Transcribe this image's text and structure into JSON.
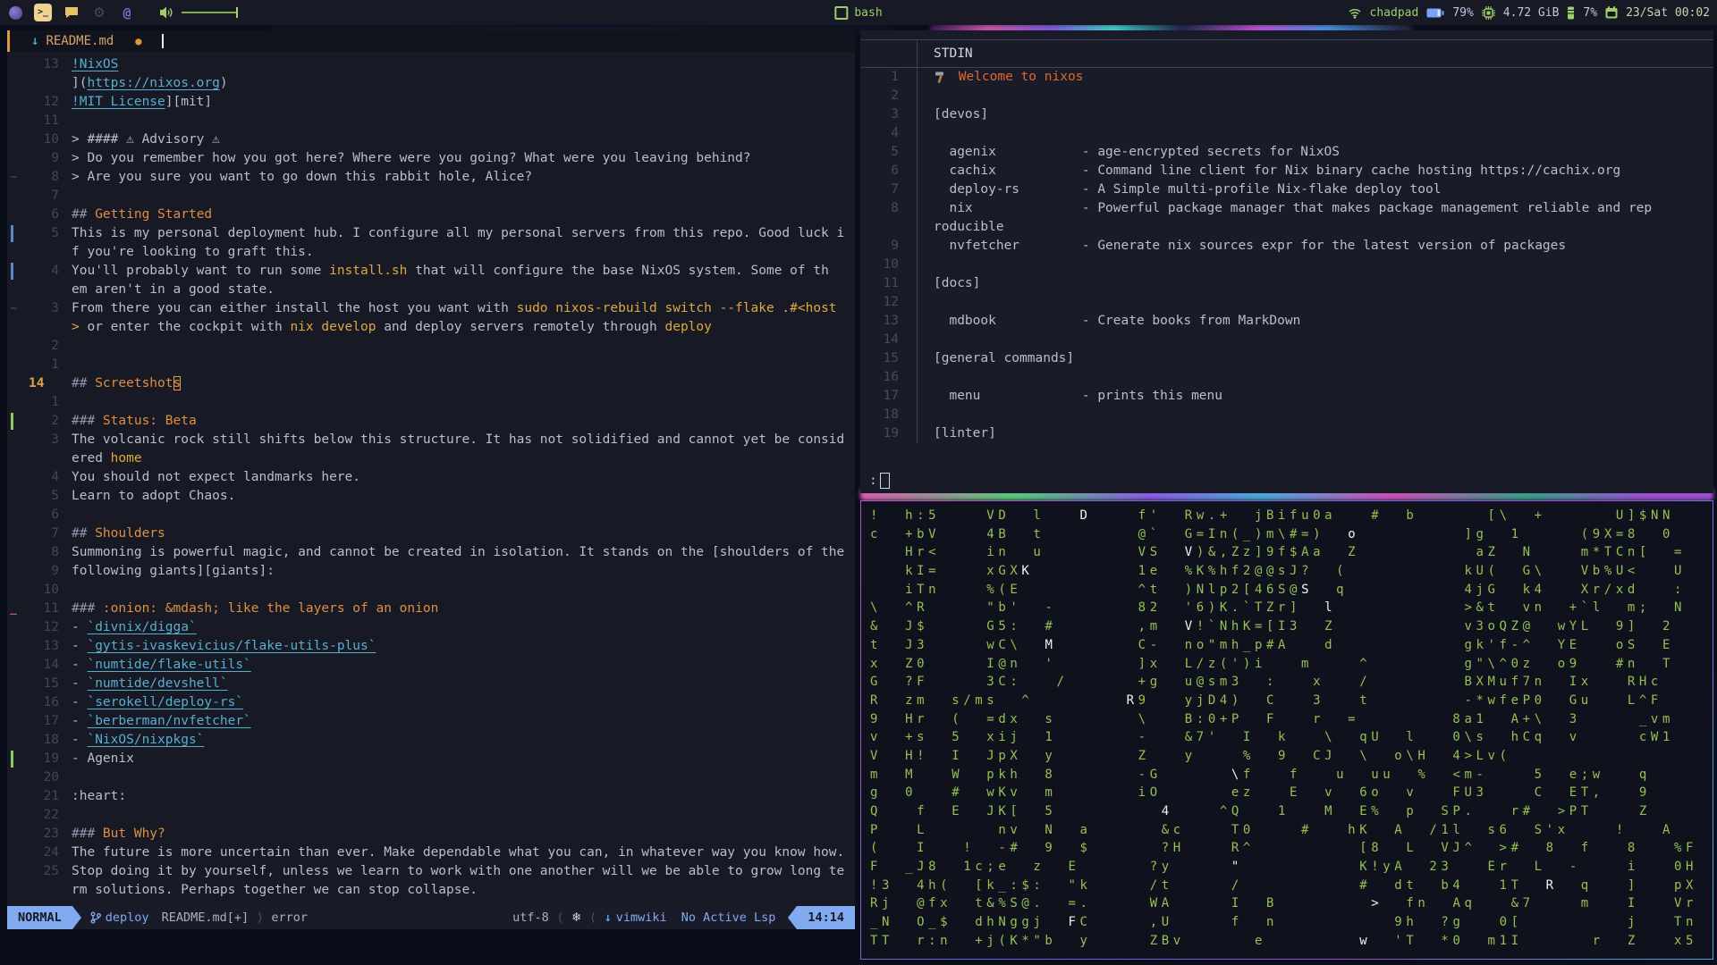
{
  "topbar": {
    "center_label": "bash",
    "host": "chadpad",
    "battery": "79%",
    "memory": "4.72 GiB",
    "cpu": "7%",
    "clock": "23/Sat 00:02",
    "accent_green": "#9ece6a",
    "accent_blue": "#7aa2f7"
  },
  "editor": {
    "winbar": {
      "icon": "↓",
      "file": "README.md",
      "modified_dot": "●"
    },
    "lines": [
      {
        "n": "13",
        "s": "",
        "g": [
          [
            "link",
            "!NixOS"
          ]
        ]
      },
      {
        "n": "",
        "s": "",
        "g": [
          [
            "plain",
            "]("
          ],
          [
            "link",
            "https://nixos.org"
          ],
          [
            "plain",
            ")"
          ]
        ]
      },
      {
        "n": "12",
        "s": "",
        "g": [
          [
            "link",
            "!MIT License"
          ],
          [
            "plain",
            "][mit]"
          ]
        ]
      },
      {
        "n": "11",
        "s": "",
        "g": []
      },
      {
        "n": "10",
        "s": "",
        "g": [
          [
            "plain",
            "> #### ⚠ Advisory ⚠"
          ]
        ]
      },
      {
        "n": "9",
        "s": "",
        "g": [
          [
            "plain",
            "> Do you remember how you got here? Where were you going? What were you leaving behind?"
          ]
        ]
      },
      {
        "n": "8",
        "s": "~",
        "g": [
          [
            "plain",
            "> Are you sure you want to go down this rabbit hole, Alice?"
          ]
        ]
      },
      {
        "n": "7",
        "s": "",
        "g": []
      },
      {
        "n": "6",
        "s": "",
        "g": [
          [
            "hash",
            "## "
          ],
          [
            "header",
            "Getting Started"
          ]
        ]
      },
      {
        "n": "5",
        "s": "ch",
        "g": [
          [
            "plain",
            "This is my personal deployment hub. I configure all my personal servers from this repo. Good luck i"
          ]
        ]
      },
      {
        "n": "",
        "s": "",
        "g": [
          [
            "plain",
            "f you're looking to graft this."
          ]
        ]
      },
      {
        "n": "4",
        "s": "ch",
        "g": [
          [
            "plain",
            "You'll probably want to run some "
          ],
          [
            "code",
            "install.sh"
          ],
          [
            "plain",
            " that will configure the base NixOS system. Some of th"
          ]
        ]
      },
      {
        "n": "",
        "s": "",
        "g": [
          [
            "plain",
            "em aren't in a good state."
          ]
        ]
      },
      {
        "n": "3",
        "s": "~",
        "g": [
          [
            "plain",
            "From there you can either install the host you want with "
          ],
          [
            "code",
            "sudo nixos-rebuild switch --flake .#<host"
          ]
        ]
      },
      {
        "n": "",
        "s": "",
        "g": [
          [
            "code",
            ">"
          ],
          [
            "plain",
            " or enter the cockpit with "
          ],
          [
            "code",
            "nix develop"
          ],
          [
            "plain",
            " and deploy servers remotely through "
          ],
          [
            "code",
            "deploy"
          ]
        ]
      },
      {
        "n": "2",
        "s": "",
        "g": []
      },
      {
        "n": "1",
        "s": "",
        "g": []
      },
      {
        "n": "14",
        "s": "",
        "c": true,
        "g": [
          [
            "hash",
            "## "
          ],
          [
            "header",
            "Screetshot"
          ],
          [
            "cursor",
            "s"
          ]
        ]
      },
      {
        "n": "1",
        "s": "",
        "g": []
      },
      {
        "n": "2",
        "s": "ad",
        "g": [
          [
            "hash",
            "### "
          ],
          [
            "header",
            "Status: Beta"
          ]
        ]
      },
      {
        "n": "3",
        "s": "",
        "g": [
          [
            "plain",
            "The volcanic rock still shifts below this structure. It has not solidified and cannot yet be consid"
          ]
        ]
      },
      {
        "n": "",
        "s": "",
        "g": [
          [
            "plain",
            "ered "
          ],
          [
            "code",
            "home"
          ]
        ]
      },
      {
        "n": "4",
        "s": "",
        "g": [
          [
            "plain",
            "You should not expect landmarks here."
          ]
        ]
      },
      {
        "n": "5",
        "s": "",
        "g": [
          [
            "plain",
            "Learn to adopt Chaos."
          ]
        ]
      },
      {
        "n": "6",
        "s": "",
        "g": []
      },
      {
        "n": "7",
        "s": "",
        "g": [
          [
            "hash",
            "## "
          ],
          [
            "header",
            "Shoulders"
          ]
        ]
      },
      {
        "n": "8",
        "s": "",
        "g": [
          [
            "plain",
            "Summoning is powerful magic, and cannot be created in isolation. It stands on the [shoulders of the"
          ]
        ]
      },
      {
        "n": "9",
        "s": "",
        "g": [
          [
            "plain",
            "following giants][giants]:"
          ]
        ]
      },
      {
        "n": "10",
        "s": "",
        "g": []
      },
      {
        "n": "11",
        "s": "de",
        "g": [
          [
            "hash",
            "### "
          ],
          [
            "header",
            ":onion: &mdash; like the layers of an onion"
          ]
        ]
      },
      {
        "n": "12",
        "s": "",
        "g": [
          [
            "plain",
            "- "
          ],
          [
            "link",
            "`divnix/digga`"
          ]
        ]
      },
      {
        "n": "13",
        "s": "",
        "g": [
          [
            "plain",
            "- "
          ],
          [
            "link",
            "`gytis-ivaskevicius/flake-utils-plus`"
          ]
        ]
      },
      {
        "n": "14",
        "s": "",
        "g": [
          [
            "plain",
            "- "
          ],
          [
            "link",
            "`numtide/flake-utils`"
          ]
        ]
      },
      {
        "n": "15",
        "s": "",
        "g": [
          [
            "plain",
            "- "
          ],
          [
            "link",
            "`numtide/devshell`"
          ]
        ]
      },
      {
        "n": "16",
        "s": "",
        "g": [
          [
            "plain",
            "- "
          ],
          [
            "link",
            "`serokell/deploy-rs`"
          ]
        ]
      },
      {
        "n": "17",
        "s": "",
        "g": [
          [
            "plain",
            "- "
          ],
          [
            "link",
            "`berberman/nvfetcher`"
          ]
        ]
      },
      {
        "n": "18",
        "s": "",
        "g": [
          [
            "plain",
            "- "
          ],
          [
            "link",
            "`NixOS/nixpkgs`"
          ]
        ]
      },
      {
        "n": "19",
        "s": "ad",
        "g": [
          [
            "plain",
            "- Agenix"
          ]
        ]
      },
      {
        "n": "20",
        "s": "",
        "g": []
      },
      {
        "n": "21",
        "s": "",
        "g": [
          [
            "plain",
            ":heart:"
          ]
        ]
      },
      {
        "n": "22",
        "s": "",
        "g": []
      },
      {
        "n": "23",
        "s": "",
        "g": [
          [
            "hash",
            "### "
          ],
          [
            "header",
            "But Why?"
          ]
        ]
      },
      {
        "n": "24",
        "s": "",
        "g": [
          [
            "plain",
            "The future is more uncertain than ever. Make dependable what you can, in whatever way you know how."
          ]
        ]
      },
      {
        "n": "25",
        "s": "",
        "g": [
          [
            "plain",
            "Stop doing it by yourself, unless we learn to work with one another will we be able to grow long te"
          ]
        ]
      },
      {
        "n": "",
        "s": "",
        "g": [
          [
            "plain",
            "rm solutions. Perhaps together we can stop collapse."
          ]
        ]
      }
    ],
    "statusline": {
      "mode": "NORMAL",
      "branch": "deploy",
      "file": "README.md[+]",
      "sep_r": "⟩",
      "error": "error",
      "encoding": "utf-8",
      "sep_l": "⟨",
      "os_icon": "❄",
      "md_icon": "↓",
      "plugin": "vimwiki",
      "lsp": "No Active Lsp",
      "time": "14:14"
    }
  },
  "pager": {
    "title": "STDIN",
    "prompt": ":",
    "lines": [
      {
        "n": "1",
        "g": [
          [
            "hammer",
            ""
          ],
          [
            "welcome",
            " Welcome to nixos"
          ]
        ]
      },
      {
        "n": "2",
        "g": []
      },
      {
        "n": "3",
        "g": [
          [
            "plain",
            "[devos]"
          ]
        ]
      },
      {
        "n": "4",
        "g": []
      },
      {
        "n": "5",
        "g": [
          [
            "plain",
            "  agenix           - age-encrypted secrets for NixOS"
          ]
        ]
      },
      {
        "n": "6",
        "g": [
          [
            "plain",
            "  cachix           - Command line client for Nix binary cache hosting https://cachix.org"
          ]
        ]
      },
      {
        "n": "7",
        "g": [
          [
            "plain",
            "  deploy-rs        - A Simple multi-profile Nix-flake deploy tool"
          ]
        ]
      },
      {
        "n": "8",
        "g": [
          [
            "plain",
            "  nix              - Powerful package manager that makes package management reliable and rep"
          ]
        ]
      },
      {
        "n": "",
        "g": [
          [
            "plain",
            "roducible"
          ]
        ]
      },
      {
        "n": "9",
        "g": [
          [
            "plain",
            "  nvfetcher        - Generate nix sources expr for the latest version of packages"
          ]
        ]
      },
      {
        "n": "10",
        "g": []
      },
      {
        "n": "11",
        "g": [
          [
            "plain",
            "[docs]"
          ]
        ]
      },
      {
        "n": "12",
        "g": []
      },
      {
        "n": "13",
        "g": [
          [
            "plain",
            "  mdbook           - Create books from MarkDown"
          ]
        ]
      },
      {
        "n": "14",
        "g": []
      },
      {
        "n": "15",
        "g": [
          [
            "plain",
            "[general commands]"
          ]
        ]
      },
      {
        "n": "16",
        "g": []
      },
      {
        "n": "17",
        "g": [
          [
            "plain",
            "  menu             - prints this menu"
          ]
        ]
      },
      {
        "n": "18",
        "g": []
      },
      {
        "n": "19",
        "g": [
          [
            "plain",
            "[linter]"
          ]
        ]
      }
    ]
  },
  "matrix": {
    "rows": [
      "!  h:5    VD  l   D    f'  Rw.+  jBifu0a   #  b      [\\  +      U]$NN",
      "c  +bV    4B  t        @`  G=In(_)m\\#=)  o         ]g  1     (9X=8  0",
      "   Hr<    in  u        VS  V)&,Zz]9f$Aa  Z          aZ  N    m*TCn[  =",
      "   kI=    xGXK         1e  %K%hf2@@sJ?  (          kU(  G\\   Vb%U<   U",
      "   iTn    %(E          ^t  )Nlp2[46S@S  q          4jG  k4   Xr/xd   :",
      "\\  ^R     \"b'  -       82  '6)K.`TZr]  l           >&t  vn  +`l  m;  N",
      "&  J$     G5:  #       ,m  V!`NhK=[I3  Z           v3oQZ@  wYL  9]  2",
      "t  J3     wC\\  M       C-  no\"mh_p#A   d           gk'f-^  YE   oS  E",
      "x  Z0     I@n  '       ]x  L/z(')i   m    ^        g\"\\^0z  o9   #n  T",
      "G  ?F     3C:   /      +g  u@sm3  :   x   /        BXMuf7n  Ix   RHc",
      "R  zm  s/ms  ^        R9   yjD4)  C   3   t        -*wfeP0  Gu   L^F",
      "9  Hr  (  =dx  s       \\   B:0+P  F   r  =        8a1  A+\\  3     _vm",
      "v  +s  5  xij  1       -   &7'  I  k   \\  qU  l   0\\s  hCq  v     cW1",
      "V  H!  I  JpX  y       Z   y    %  9  CJ  \\  o\\H  4>Lv(",
      "m  M   W  pkh  8       -G      \\f   f   u  uu  %  <m-    5  e;w   q",
      "g  0   #  wKv  m       iO      ez   E  v  6o  v   FU3    C  ET,   9",
      "Q   f  E  JK[  5         4    ^Q   1   M  E%  p  SP.   r#  >PT    Z",
      "P   L      nv  N  a      &c    T0    #   hK  A  /1l  s6  S'x    !   A",
      "(   I   !  -#  9  $      ?H    R^         [8  L  VJ^  >#  8  f   8   %F",
      "F  _J8  1c;e  z  E      ?y     \"          K!yA  23   Er  L  -    i   0H",
      "!3  4h(  [k_:$:  \"k     /t     /          #  dt  b4   1T  R  q   ]   pX",
      "Rj  @fx  t&%S@.  =.     WA     I  B        >  fn  Aq   &7    m   I   Vr",
      "_N  O_$  dhNggj  FC     ,U     f  n          9h  ?g   0[         j   Tn",
      "TT  r:n  +j(K*\"b  y     ZBv      e        w  'T  *0  m1I      r  Z   x5"
    ],
    "bright": [
      [
        0,
        18
      ],
      [
        1,
        41
      ],
      [
        2,
        27
      ],
      [
        3,
        13
      ],
      [
        4,
        37
      ],
      [
        5,
        39
      ],
      [
        6,
        27
      ],
      [
        7,
        15
      ],
      [
        10,
        22
      ],
      [
        12,
        26
      ],
      [
        14,
        31
      ],
      [
        16,
        25
      ],
      [
        19,
        31
      ],
      [
        20,
        58
      ],
      [
        21,
        43
      ],
      [
        22,
        17
      ],
      [
        23,
        42
      ]
    ]
  }
}
